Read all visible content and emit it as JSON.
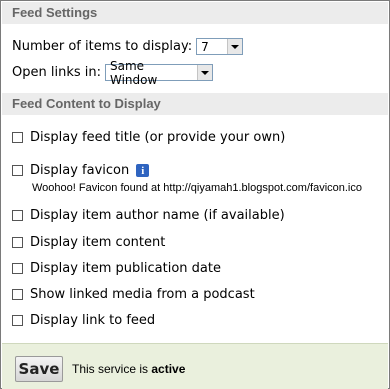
{
  "feed_settings": {
    "title": "Feed Settings",
    "items_label": "Number of items to display:",
    "items_value": "7",
    "links_label": "Open links in:",
    "links_value": "Same Window"
  },
  "content": {
    "title": "Feed Content to Display",
    "options": [
      {
        "label": "Display feed title (or provide your own)",
        "checked": false
      },
      {
        "label": "Display favicon",
        "checked": false
      },
      {
        "label": "Display item author name (if available)",
        "checked": false
      },
      {
        "label": "Display item content",
        "checked": false
      },
      {
        "label": "Display item publication date",
        "checked": false
      },
      {
        "label": "Show linked media from a podcast",
        "checked": false
      },
      {
        "label": "Display link to feed",
        "checked": false
      }
    ],
    "favicon_info_glyph": "i",
    "favicon_note": "Woohoo! Favicon found at http://qiyamah1.blogspot.com/favicon.ico"
  },
  "footer": {
    "save_label": "Save",
    "status_prefix": "This service is",
    "status_value": "active"
  },
  "colors": {
    "header_bg": "#ececec",
    "footer_bg": "#eaf0dd",
    "info_icon": "#2f64c0"
  }
}
